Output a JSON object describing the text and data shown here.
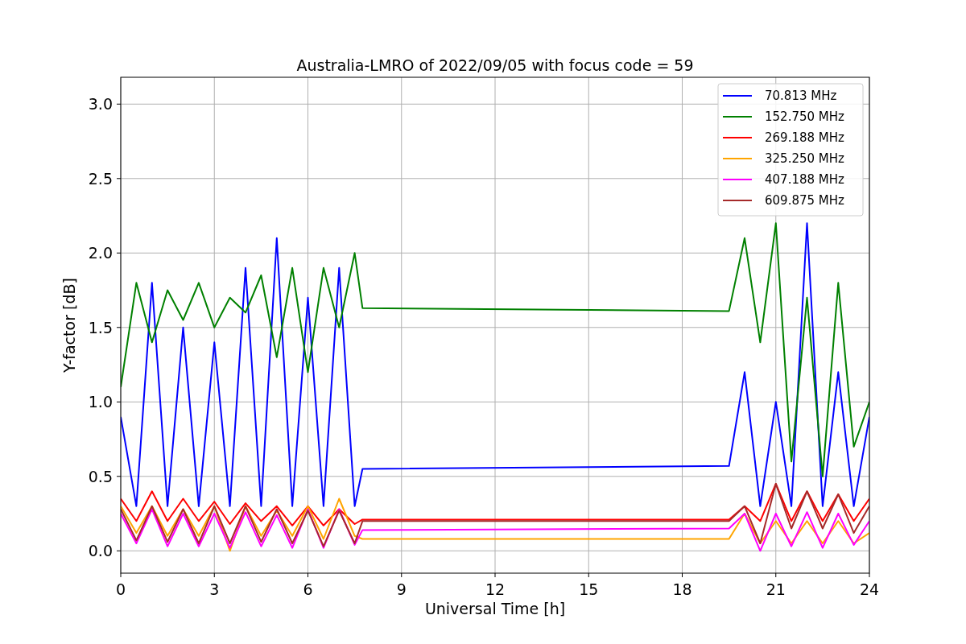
{
  "figure": {
    "chart_data": {
      "type": "line",
      "title": "Australia-LMRO of 2022/09/05 with focus code = 59",
      "xlabel": "Universal Time [h]",
      "ylabel": "Y-factor [dB]",
      "x": [
        0,
        0.5,
        1,
        1.5,
        2,
        2.5,
        3,
        3.5,
        4,
        4.5,
        5,
        5.5,
        6,
        6.5,
        7,
        7.5,
        7.75,
        19.5,
        20,
        20.5,
        21,
        21.5,
        22,
        22.5,
        23,
        23.5,
        24
      ],
      "series": [
        {
          "name": "70.813 MHz",
          "color": "#0000ff",
          "values": [
            0.9,
            0.3,
            1.8,
            0.3,
            1.5,
            0.3,
            1.4,
            0.3,
            1.9,
            0.3,
            2.1,
            0.3,
            1.7,
            0.3,
            1.9,
            0.3,
            0.55,
            0.57,
            1.2,
            0.3,
            1.0,
            0.3,
            2.2,
            0.3,
            1.2,
            0.3,
            0.9
          ]
        },
        {
          "name": "152.750 MHz",
          "color": "#008000",
          "values": [
            1.1,
            1.8,
            1.4,
            1.75,
            1.55,
            1.8,
            1.5,
            1.7,
            1.6,
            1.85,
            1.3,
            1.9,
            1.2,
            1.9,
            1.5,
            2.0,
            1.63,
            1.61,
            2.1,
            1.4,
            2.2,
            0.6,
            1.7,
            0.5,
            1.8,
            0.7,
            1.0
          ]
        },
        {
          "name": "269.188 MHz",
          "color": "#ff0000",
          "values": [
            0.35,
            0.2,
            0.4,
            0.2,
            0.35,
            0.2,
            0.33,
            0.18,
            0.32,
            0.2,
            0.3,
            0.17,
            0.3,
            0.17,
            0.28,
            0.18,
            0.21,
            0.21,
            0.3,
            0.2,
            0.45,
            0.2,
            0.4,
            0.2,
            0.38,
            0.2,
            0.35
          ]
        },
        {
          "name": "325.250 MHz",
          "color": "#ffa500",
          "values": [
            0.3,
            0.12,
            0.3,
            0.1,
            0.28,
            0.1,
            0.3,
            0.0,
            0.3,
            0.1,
            0.27,
            0.1,
            0.3,
            0.08,
            0.35,
            0.1,
            0.08,
            0.08,
            0.25,
            0.05,
            0.2,
            0.05,
            0.2,
            0.05,
            0.2,
            0.05,
            0.12
          ]
        },
        {
          "name": "407.188 MHz",
          "color": "#ff00ff",
          "values": [
            0.25,
            0.05,
            0.28,
            0.03,
            0.25,
            0.03,
            0.25,
            0.02,
            0.26,
            0.03,
            0.24,
            0.02,
            0.28,
            0.02,
            0.28,
            0.04,
            0.14,
            0.15,
            0.25,
            0.0,
            0.25,
            0.03,
            0.26,
            0.02,
            0.25,
            0.04,
            0.2
          ]
        },
        {
          "name": "609.875 MHz",
          "color": "#a52a2a",
          "values": [
            0.28,
            0.07,
            0.3,
            0.06,
            0.28,
            0.05,
            0.3,
            0.05,
            0.3,
            0.06,
            0.28,
            0.05,
            0.27,
            0.03,
            0.27,
            0.05,
            0.2,
            0.2,
            0.3,
            0.05,
            0.45,
            0.15,
            0.4,
            0.15,
            0.38,
            0.12,
            0.3
          ]
        }
      ],
      "grid": true,
      "legend": true,
      "xlim": [
        0,
        24
      ],
      "ylim": [
        -0.15,
        3.18
      ],
      "xticks": [
        0,
        3,
        6,
        9,
        12,
        15,
        18,
        21,
        24
      ],
      "yticks": [
        {
          "value": 0,
          "label": "0.0"
        },
        {
          "value": 0.5,
          "label": "0.5"
        },
        {
          "value": 1,
          "label": "1.0"
        },
        {
          "value": 1.5,
          "label": "1.5"
        },
        {
          "value": 2,
          "label": "2.0"
        },
        {
          "value": 2.5,
          "label": "2.5"
        },
        {
          "value": 3,
          "label": "3.0"
        }
      ]
    }
  }
}
